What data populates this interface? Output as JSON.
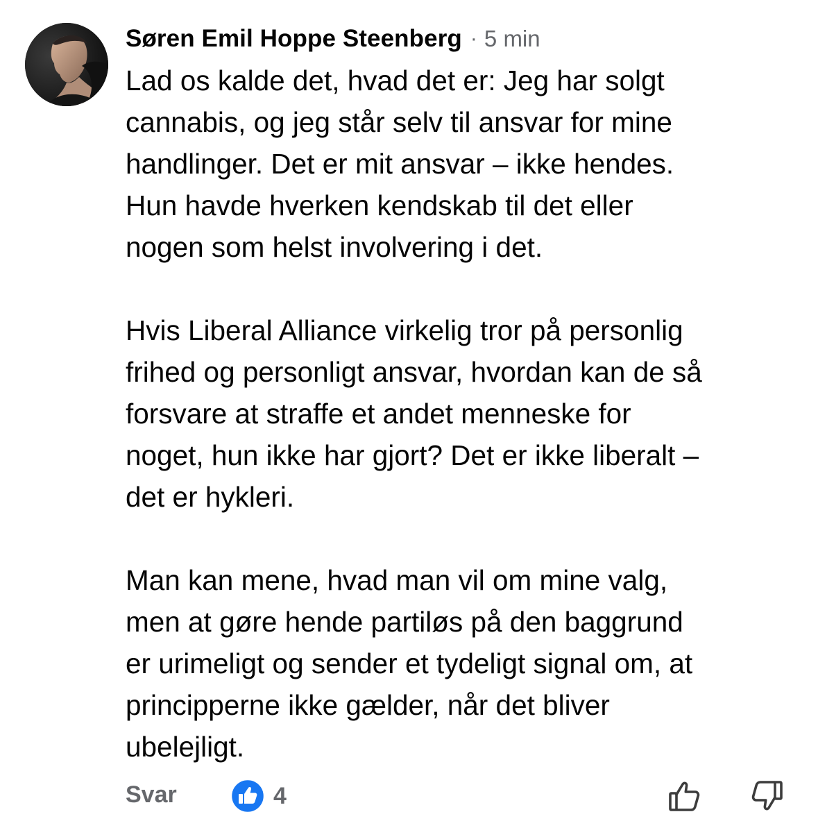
{
  "comment": {
    "author": "Søren Emil Hoppe Steenberg",
    "separator": "·",
    "timestamp": "5 min",
    "paragraphs": [
      [
        "Lad os kalde det, hvad det er: Jeg har solgt",
        "cannabis, og jeg står selv til ansvar for mine",
        "handlinger. Det er mit ansvar – ikke hendes.",
        "Hun havde hverken kendskab til det eller",
        "nogen som helst involvering i det."
      ],
      [
        "Hvis Liberal Alliance virkelig tror på personlig",
        "frihed og personligt ansvar, hvordan kan de så",
        "forsvare at straffe et andet menneske for",
        "noget, hun ikke har gjort? Det er ikke liberalt –",
        "det er hykleri."
      ],
      [
        "Man kan mene, hvad man vil om mine valg,",
        "men at gøre hende partiløs på den baggrund",
        "er urimeligt og sender et tydeligt signal om, at",
        "principperne ikke gælder, når det bliver",
        "ubelejligt."
      ]
    ]
  },
  "footer": {
    "reply_label": "Svar",
    "like_count": "4",
    "like_icon": "facebook-like-badge",
    "upvote_icon": "thumb-up-outline-icon",
    "downvote_icon": "thumb-down-outline-icon"
  },
  "colors": {
    "text": "#050505",
    "secondary": "#65676b",
    "like_blue": "#1877f2",
    "background": "#ffffff"
  }
}
